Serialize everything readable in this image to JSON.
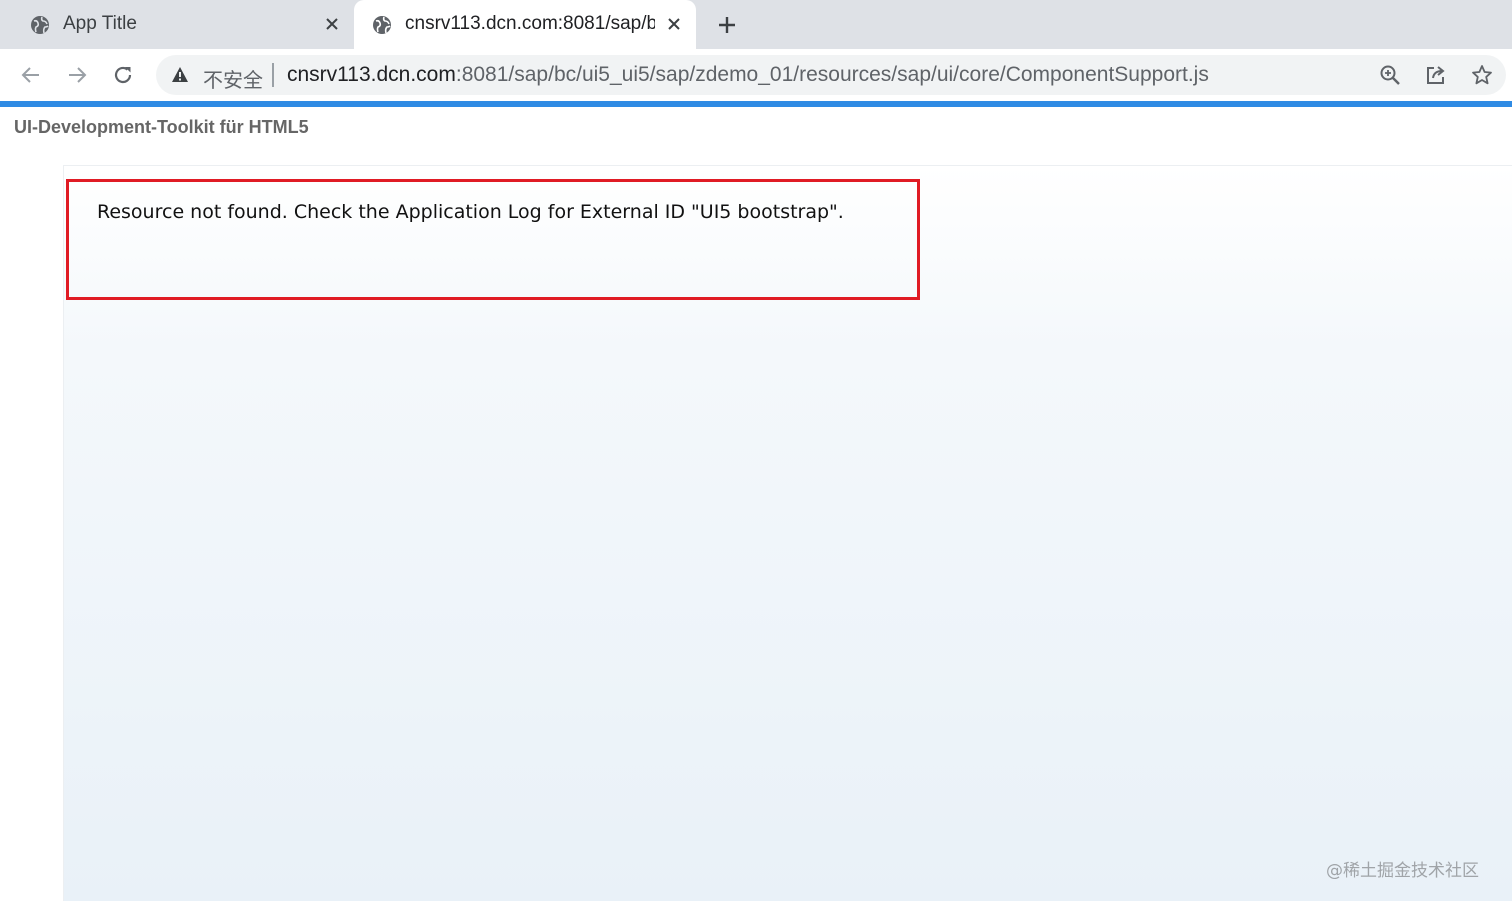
{
  "tabs": [
    {
      "title": "App Title",
      "active": false,
      "icon": "globe-icon"
    },
    {
      "title": "cnsrv113.dcn.com:8081/sap/bc",
      "active": true,
      "icon": "globe-icon"
    }
  ],
  "toolbar": {
    "security_label": "不安全",
    "url_host": "cnsrv113.dcn.com",
    "url_rest": ":8081/sap/bc/ui5_ui5/sap/zdemo_01/resources/sap/ui/core/ComponentSupport.js"
  },
  "page": {
    "header": "UI-Development-Toolkit für HTML5",
    "error_message": "Resource not found. Check the Application Log for External ID \"UI5 bootstrap\"."
  },
  "watermark": {
    "footer": "@稀土掘金技术社区"
  },
  "colors": {
    "tabstrip": "#dee1e6",
    "accent_bar": "#2f8be4",
    "error_border": "#e01b24",
    "header_text": "#666666"
  }
}
